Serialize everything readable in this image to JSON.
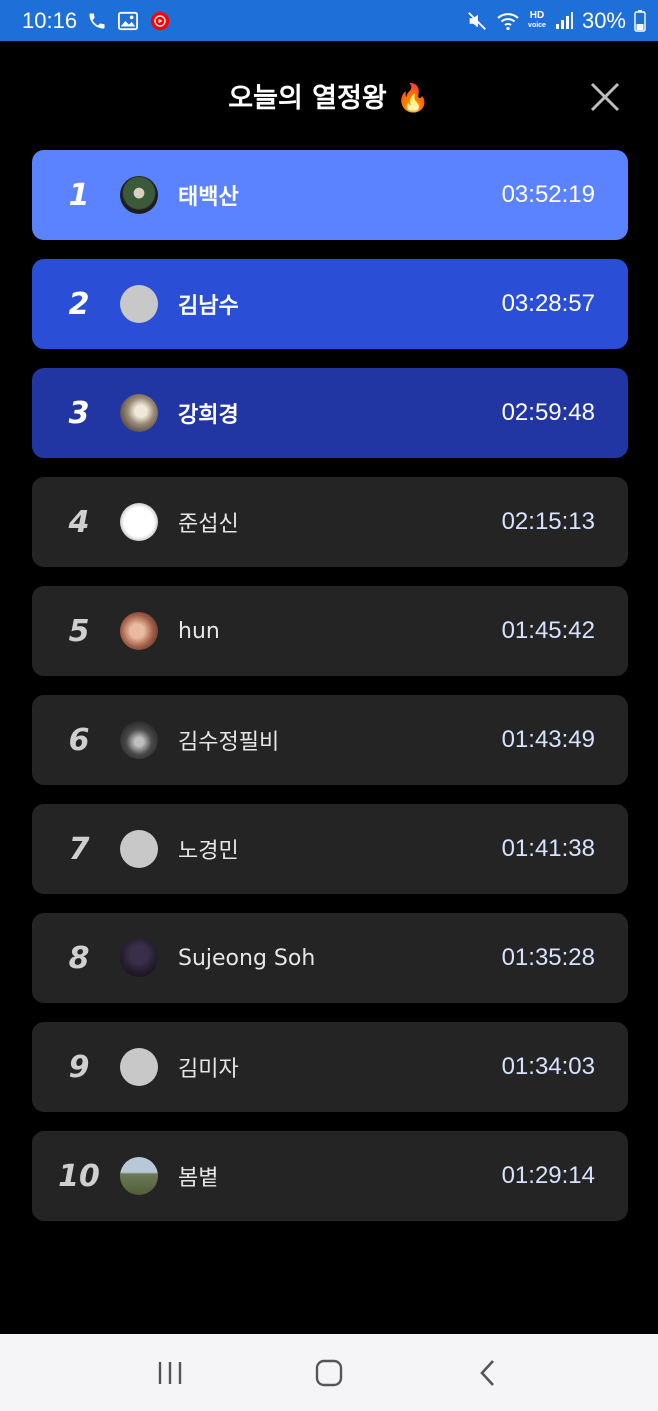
{
  "status_bar": {
    "time": "10:16",
    "battery": "30%",
    "icons": [
      "phone-icon",
      "gallery-icon",
      "youtube-music-icon",
      "mute-icon",
      "wifi-icon",
      "hd-voice-icon",
      "signal-icon",
      "battery-icon"
    ],
    "hd_line1": "HD",
    "hd_line2": "voice"
  },
  "header": {
    "title": "오늘의 열정왕 🔥",
    "close_icon": "close-icon"
  },
  "colors": {
    "background": "#000000",
    "status_bar": "#1f6fd9",
    "rank1": "#5c83ff",
    "rank2": "#2a4fd6",
    "rank3": "#2136a2",
    "row": "#242424",
    "time_text": "#d8e2ff"
  },
  "ranking": [
    {
      "rank": "1",
      "name": "태백산",
      "time": "03:52:19",
      "avatar": "photo"
    },
    {
      "rank": "2",
      "name": "김남수",
      "time": "03:28:57",
      "avatar": "default"
    },
    {
      "rank": "3",
      "name": "강희경",
      "time": "02:59:48",
      "avatar": "photo"
    },
    {
      "rank": "4",
      "name": "준섭신",
      "time": "02:15:13",
      "avatar": "photo"
    },
    {
      "rank": "5",
      "name": "hun",
      "time": "01:45:42",
      "avatar": "photo"
    },
    {
      "rank": "6",
      "name": "김수정필비",
      "time": "01:43:49",
      "avatar": "photo"
    },
    {
      "rank": "7",
      "name": "노경민",
      "time": "01:41:38",
      "avatar": "default"
    },
    {
      "rank": "8",
      "name": "Sujeong Soh",
      "time": "01:35:28",
      "avatar": "photo"
    },
    {
      "rank": "9",
      "name": "김미자",
      "time": "01:34:03",
      "avatar": "default"
    },
    {
      "rank": "10",
      "name": "봄볕",
      "time": "01:29:14",
      "avatar": "photo"
    }
  ],
  "nav_bar": {
    "buttons": [
      "recent-apps-icon",
      "home-icon",
      "back-icon"
    ]
  }
}
